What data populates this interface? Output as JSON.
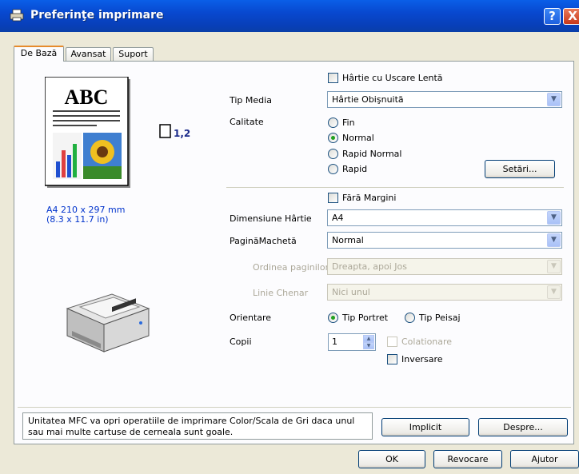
{
  "window": {
    "title": "Preferinţe imprimare",
    "help_button": "?",
    "close_button": "X"
  },
  "tabs": [
    {
      "label": "De Bază",
      "active": true
    },
    {
      "label": "Avansat",
      "active": false
    },
    {
      "label": "Suport",
      "active": false
    }
  ],
  "preview": {
    "abc_text": "ABC",
    "copies_icon_text": "1,2",
    "paper_size_line1": "A4 210 x 297 mm",
    "paper_size_line2": "(8.3 x 11.7 in)"
  },
  "media": {
    "slow_dry_label": "Hârtie cu Uscare Lentă",
    "slow_dry_checked": false,
    "media_type_label": "Tip Media",
    "media_type_value": "Hârtie Obişnuită"
  },
  "quality": {
    "label": "Calitate",
    "options": [
      "Fin",
      "Normal",
      "Rapid Normal",
      "Rapid"
    ],
    "selected": "Normal",
    "settings_button": "Setări..."
  },
  "paper": {
    "borderless_label": "Fără Margini",
    "borderless_checked": false,
    "size_label": "Dimensiune Hârtie",
    "size_value": "A4",
    "layout_label": "PaginăMachetă",
    "layout_value": "Normal",
    "page_order_label": "Ordinea paginilor",
    "page_order_value": "Dreapta, apoi Jos",
    "border_line_label": "Linie Chenar",
    "border_line_value": "Nici unul"
  },
  "orientation": {
    "label": "Orientare",
    "portrait": "Tip Portret",
    "landscape": "Tip Peisaj",
    "selected": "Tip Portret"
  },
  "copies": {
    "label": "Copii",
    "value": "1",
    "collate_label": "Colationare",
    "reverse_label": "Inversare"
  },
  "status_message": "Unitatea MFC va opri operatiile de imprimare Color/Scala de Gri daca unul sau mai multe cartuse de cerneala sunt goale.",
  "footer": {
    "default_button": "Implicit",
    "about_button": "Despre...",
    "ok_button": "OK",
    "cancel_button": "Revocare",
    "help_button": "Ajutor"
  }
}
